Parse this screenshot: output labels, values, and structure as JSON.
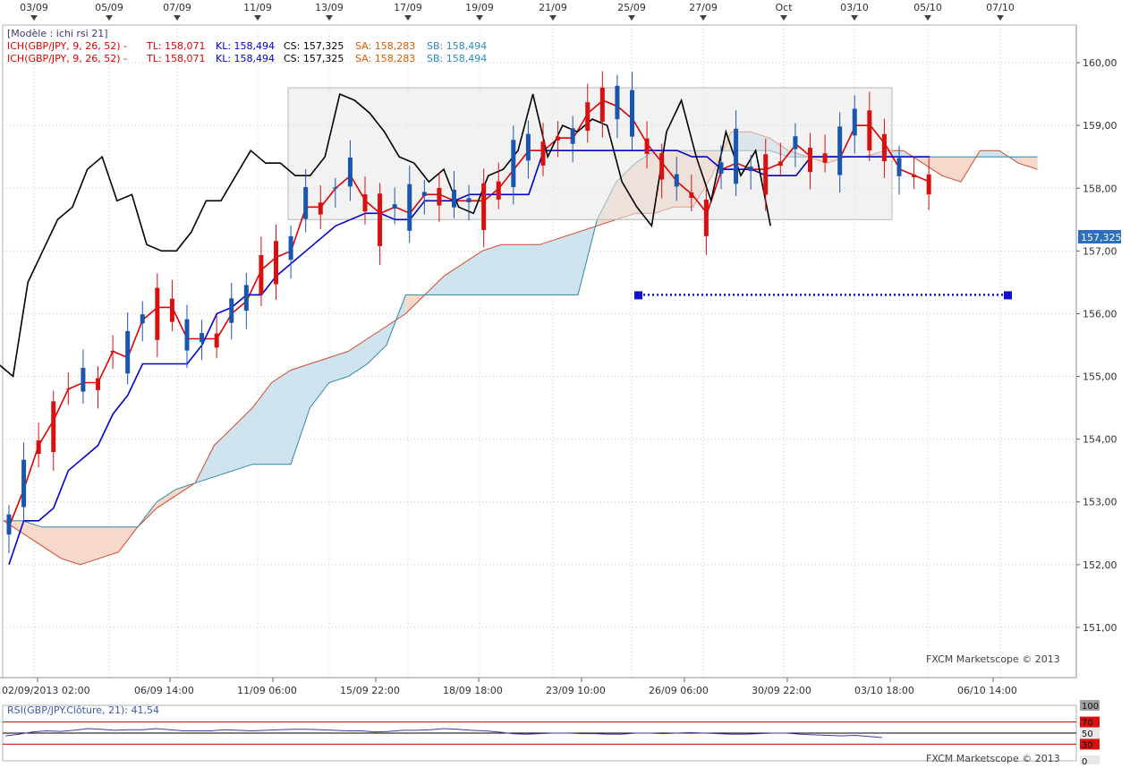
{
  "header": {
    "template_label": "[Modèle : ichi rsi 21]",
    "legend_rows": [
      {
        "prefix": "ICH(GBP/JPY, 9, 26, 52) -",
        "tl": "TL: 158,071",
        "kl": "KL: 158,494",
        "cs": "CS: 157,325",
        "sa": "SA: 158,283",
        "sb": "SB: 158,494"
      },
      {
        "prefix": "ICH(GBP/JPY, 9, 26, 52) -",
        "tl": "TL: 158,071",
        "kl": "KL: 158,494",
        "cs": "CS: 157,325",
        "sa": "SA: 158,283",
        "sb": "SB: 158,494"
      }
    ]
  },
  "top_date_labels": [
    "03/09",
    "05/09",
    "07/09",
    "11/09",
    "13/09",
    "17/09",
    "19/09",
    "21/09",
    "25/09",
    "27/09",
    "Oct",
    "03/10",
    "05/10",
    "07/10"
  ],
  "bottom_date_labels": [
    "02/09/2013 02:00",
    "06/09 14:00",
    "11/09 06:00",
    "15/09 22:00",
    "18/09 18:00",
    "23/09 10:00",
    "26/09 06:00",
    "30/09 22:00",
    "03/10 18:00",
    "06/10 14:00"
  ],
  "price_axis_labels": [
    "160,00",
    "159,00",
    "158,00",
    "157,00",
    "156,00",
    "155,00",
    "154,00",
    "153,00",
    "152,00",
    "151,00"
  ],
  "current_price_label": "157,325",
  "watermark": "FXCM Marketscope © 2013",
  "rsi": {
    "label": "RSI(GBP/JPY.Clôture, 21): 41,54",
    "axis_labels": [
      "100",
      "70",
      "50",
      "30",
      "0"
    ],
    "levels": [
      70,
      50,
      30
    ]
  },
  "colors": {
    "background": "#ffffff",
    "grid": "#c8c8c8",
    "tenkan": "#e00000",
    "kijun": "#0000cc",
    "chikou": "#000000",
    "kumo_bull": "#cfe3ef",
    "kumo_bear": "#f6d9cb",
    "span_a_edge": "#d04a2a",
    "span_b_edge": "#2a8aa6",
    "candle_up": "#1a55b0",
    "candle_down": "#d81010",
    "rsi_line": "#3a3aa8",
    "rsi_level": "#cc0000",
    "label_tl": "#e00000",
    "label_kl": "#0000cc",
    "label_cs": "#000000",
    "label_sa": "#e05a00",
    "label_sb": "#2a8ac0"
  },
  "chart_data": {
    "type": "line",
    "symbol": "GBP/JPY",
    "ylim": [
      150.2,
      160.6
    ],
    "grid": true,
    "series": [
      {
        "name": "Tenkan (TL)",
        "values": [
          152.6,
          153.2,
          153.9,
          154.3,
          154.8,
          154.9,
          154.9,
          155.4,
          155.3,
          155.9,
          156.1,
          156.1,
          155.6,
          155.6,
          155.6,
          156.0,
          156.2,
          156.7,
          156.9,
          157.0,
          157.7,
          157.7,
          158.0,
          158.2,
          157.8,
          157.6,
          157.7,
          157.6,
          157.9,
          157.9,
          157.8,
          157.8,
          157.8,
          158.0,
          158.3,
          158.6,
          158.6,
          158.8,
          158.8,
          159.2,
          159.4,
          159.3,
          159.1,
          158.7,
          158.4,
          158.1,
          157.9,
          157.6,
          158.3,
          158.4,
          158.3,
          158.3,
          158.4,
          158.7,
          158.5,
          158.5,
          158.5,
          159.0,
          159.0,
          158.7,
          158.3,
          158.2,
          158.1
        ]
      },
      {
        "name": "Kijun (KL)",
        "values": [
          152.0,
          152.7,
          152.7,
          152.9,
          153.5,
          153.7,
          153.9,
          154.4,
          154.7,
          155.2,
          155.2,
          155.2,
          155.2,
          155.5,
          156.0,
          156.1,
          156.3,
          156.3,
          156.6,
          156.8,
          157.0,
          157.2,
          157.4,
          157.5,
          157.6,
          157.6,
          157.5,
          157.5,
          157.8,
          157.8,
          157.8,
          157.9,
          157.9,
          157.9,
          157.9,
          157.9,
          158.6,
          158.6,
          158.6,
          158.6,
          158.6,
          158.6,
          158.6,
          158.6,
          158.6,
          158.6,
          158.5,
          158.5,
          158.3,
          158.3,
          158.3,
          158.2,
          158.2,
          158.2,
          158.5,
          158.5,
          158.5,
          158.5,
          158.5,
          158.5,
          158.5,
          158.5,
          158.5
        ]
      },
      {
        "name": "Chikou (CS)",
        "values": [
          155.2,
          155.0,
          156.5,
          157.0,
          157.5,
          157.7,
          158.3,
          158.5,
          157.8,
          157.9,
          157.1,
          157.0,
          157.0,
          157.3,
          157.8,
          157.8,
          158.2,
          158.6,
          158.4,
          158.4,
          158.2,
          158.2,
          158.5,
          159.5,
          159.4,
          159.2,
          158.9,
          158.5,
          158.4,
          158.1,
          158.3,
          157.7,
          157.6,
          158.2,
          158.3,
          158.6,
          159.5,
          158.5,
          159.0,
          158.9,
          159.1,
          159.0,
          158.1,
          157.7,
          157.4,
          158.9,
          159.4,
          158.5,
          157.8,
          158.9,
          158.2,
          158.6,
          157.4
        ]
      }
    ],
    "kumo": {
      "span_a": [
        152.7,
        152.5,
        152.3,
        152.1,
        152.0,
        152.1,
        152.2,
        152.6,
        152.9,
        153.1,
        153.3,
        153.9,
        154.2,
        154.5,
        154.9,
        155.1,
        155.2,
        155.3,
        155.4,
        155.6,
        155.8,
        156.0,
        156.3,
        156.6,
        156.8,
        157.0,
        157.1,
        157.1,
        157.1,
        157.2,
        157.3,
        157.4,
        157.5,
        157.6,
        157.6,
        157.7,
        157.7,
        158.2,
        158.9,
        158.9,
        158.8,
        158.6,
        158.5,
        158.4,
        158.5,
        158.5,
        158.6,
        158.6,
        158.4,
        158.2,
        158.1,
        158.6,
        158.6,
        158.4,
        158.3
      ],
      "span_b": [
        152.7,
        152.7,
        152.6,
        152.6,
        152.6,
        152.6,
        152.6,
        152.6,
        153.0,
        153.2,
        153.3,
        153.4,
        153.5,
        153.6,
        153.6,
        153.6,
        154.5,
        154.9,
        155.0,
        155.2,
        155.5,
        156.3,
        156.3,
        156.3,
        156.3,
        156.3,
        156.3,
        156.3,
        156.3,
        156.3,
        156.3,
        157.5,
        158.1,
        158.4,
        158.6,
        158.6,
        158.6,
        158.6,
        158.6,
        158.6,
        158.6,
        158.5,
        158.5,
        158.5,
        158.5,
        158.5,
        158.5,
        158.5,
        158.5,
        158.5,
        158.5,
        158.5,
        158.5,
        158.5,
        158.5
      ]
    },
    "horizontal_line": {
      "value": 156.3,
      "style": "dotted"
    },
    "rectangle_zone": {
      "high": 159.6,
      "low": 157.5
    },
    "rsi_values": [
      45,
      48,
      52,
      54,
      53,
      55,
      58,
      57,
      55,
      56,
      56,
      58,
      56,
      54,
      54,
      54,
      56,
      55,
      54,
      55,
      56,
      57,
      57,
      56,
      55,
      54,
      54,
      52,
      53,
      55,
      55,
      56,
      58,
      57,
      55,
      54,
      52,
      49,
      48,
      49,
      50,
      50,
      49,
      49,
      48,
      48,
      50,
      50,
      49,
      50,
      51,
      50,
      49,
      48,
      48,
      49,
      50,
      50,
      48,
      47,
      46,
      45,
      46,
      44,
      42
    ]
  }
}
